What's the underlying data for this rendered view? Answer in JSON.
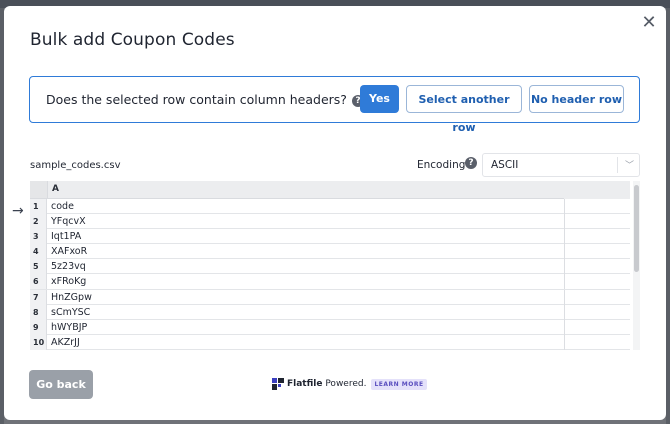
{
  "dialog": {
    "title": "Bulk add Coupon Codes",
    "close_symbol": "✕"
  },
  "question": {
    "text": "Does the selected row contain column headers?",
    "help_symbol": "?",
    "yes_label": "Yes",
    "another_label": "Select another row",
    "no_header_label": "No header row"
  },
  "file": {
    "name": "sample_codes.csv"
  },
  "encoding": {
    "label": "Encoding",
    "help_symbol": "?",
    "value": "ASCII",
    "chevron": "﹀"
  },
  "grid": {
    "column_header": "A",
    "selected_row_marker": "→",
    "rows": [
      {
        "no": "1",
        "value": "code"
      },
      {
        "no": "2",
        "value": "YFqcvX"
      },
      {
        "no": "3",
        "value": "Iqt1PA"
      },
      {
        "no": "4",
        "value": "XAFxoR"
      },
      {
        "no": "5",
        "value": "5z23vq"
      },
      {
        "no": "6",
        "value": "xFRoKg"
      },
      {
        "no": "7",
        "value": "HnZGpw"
      },
      {
        "no": "8",
        "value": "sCmYSC"
      },
      {
        "no": "9",
        "value": "hWYBJP"
      },
      {
        "no": "10",
        "value": "AKZrJJ"
      }
    ]
  },
  "footer": {
    "back_label": "Go back",
    "powered_brand": "Flatfile",
    "powered_suffix": " Powered.",
    "learn_more": "LEARN MORE"
  },
  "colors": {
    "accent": "#2f7bd8",
    "back_button": "#9aa0a8",
    "learn_more_bg": "#e4e1fa"
  }
}
